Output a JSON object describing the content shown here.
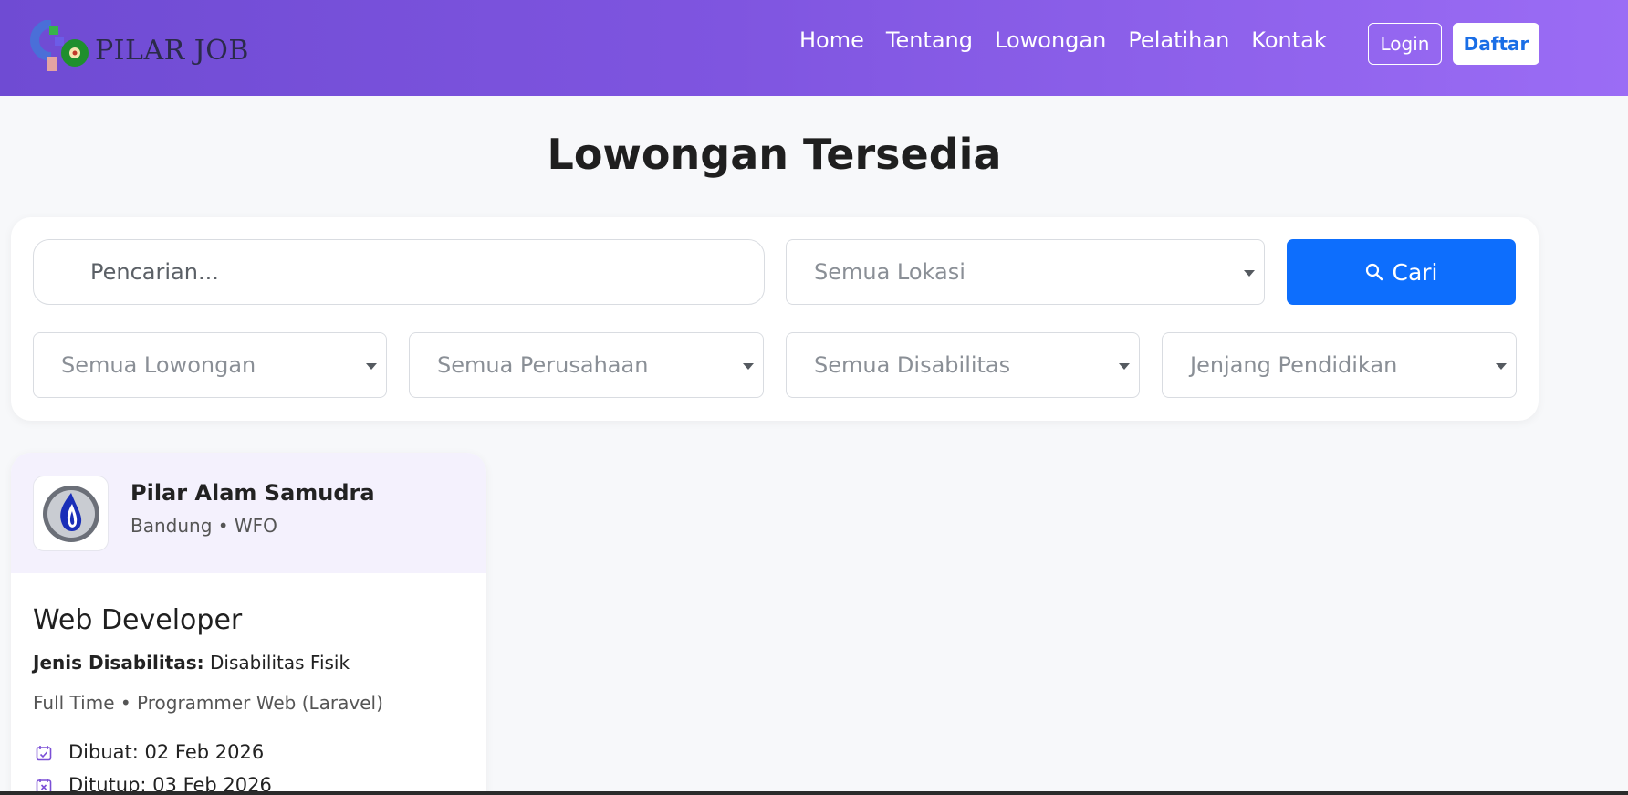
{
  "brand": {
    "name": "PILAR JOB"
  },
  "nav": {
    "links": [
      "Home",
      "Tentang",
      "Lowongan",
      "Pelatihan",
      "Kontak"
    ],
    "login": "Login",
    "register": "Daftar"
  },
  "page": {
    "title": "Lowongan Tersedia"
  },
  "filters": {
    "search_placeholder": "Pencarian...",
    "location": "Semua Lokasi",
    "job_type": "Semua Lowongan",
    "company": "Semua Perusahaan",
    "disability": "Semua Disabilitas",
    "education": "Jenjang Pendidikan",
    "search_button": "Cari"
  },
  "jobs": [
    {
      "company": "Pilar Alam Samudra",
      "location": "Bandung • WFO",
      "title": "Web Developer",
      "disability_label": "Jenis Disabilitas:",
      "disability_value": "Disabilitas Fisik",
      "meta": "Full Time • Programmer Web (Laravel)",
      "created": "Dibuat: 02 Feb 2026",
      "closed": "Ditutup: 03 Feb 2026"
    }
  ],
  "colors": {
    "nav_gradient_start": "#6f4bd3",
    "nav_gradient_end": "#9b6cf5",
    "primary_button": "#0d6efd",
    "accent_icon": "#7b4fd6"
  },
  "icons": {
    "search_button": "search-icon",
    "created": "calendar-check-icon",
    "closed": "calendar-x-icon",
    "company_logo": "flame-logo"
  }
}
